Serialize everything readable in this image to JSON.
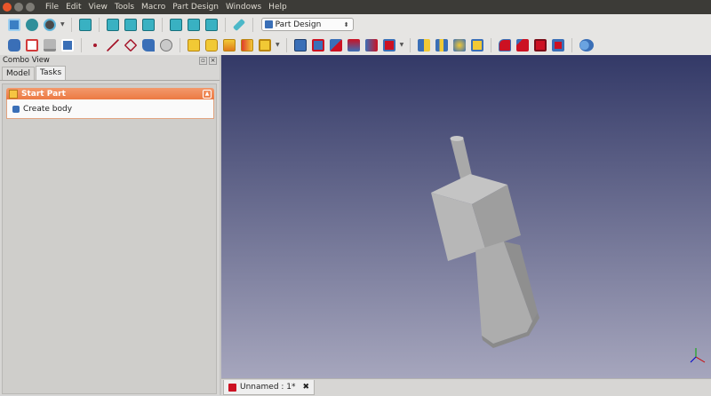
{
  "menubar": {
    "items": [
      "File",
      "Edit",
      "View",
      "Tools",
      "Macro",
      "Part Design",
      "Windows",
      "Help"
    ]
  },
  "toolbar": {
    "workbench": "Part Design"
  },
  "combo_view": {
    "title": "Combo View",
    "tabs": [
      "Model",
      "Tasks"
    ],
    "active_tab": "Tasks",
    "task_panel": {
      "header": "Start Part",
      "item": "Create body"
    }
  },
  "document_tab": {
    "label": "Unnamed : 1*"
  },
  "icons": {
    "close": "close-icon",
    "collapse": "chevron-up-icon"
  },
  "colors": {
    "menubar_bg": "#3c3b37",
    "task_header": "#ec7a43",
    "viewport_top": "#333967",
    "viewport_bottom": "#a6a6bd",
    "model": "#b5b5b5"
  }
}
